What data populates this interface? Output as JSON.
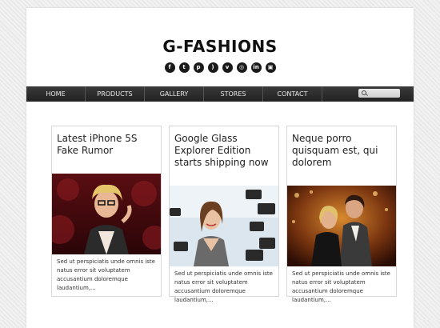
{
  "site": {
    "logo": "G-FASHIONS"
  },
  "social_icons": [
    "facebook-icon",
    "twitter-icon",
    "pinterest-icon",
    "rss-icon",
    "vimeo-icon",
    "dribbble-icon",
    "linkedin-icon",
    "instagram-icon"
  ],
  "nav": {
    "items": [
      "HOME",
      "PRODUCTS",
      "GALLERY",
      "STORES",
      "CONTACT"
    ]
  },
  "cards": [
    {
      "title": "Latest iPhone 5S Fake Rumor",
      "excerpt": "Sed ut perspiciatis unde omnis iste natus error sit voluptatem accusantium doloremque laudantium,..."
    },
    {
      "title": "Google Glass Explorer Edition starts shipping now",
      "excerpt": "Sed ut perspiciatis unde omnis iste natus error sit voluptatem accusantium doloremque laudantium,..."
    },
    {
      "title": "Neque porro quisquam est, qui dolorem",
      "excerpt": "Sed ut perspiciatis unde omnis iste natus error sit voluptatem accusantium doloremque laudantium,..."
    }
  ],
  "colors": {
    "nav_bg": "#2b2b2b",
    "page_bg": "#ffffff",
    "text": "#222222"
  }
}
